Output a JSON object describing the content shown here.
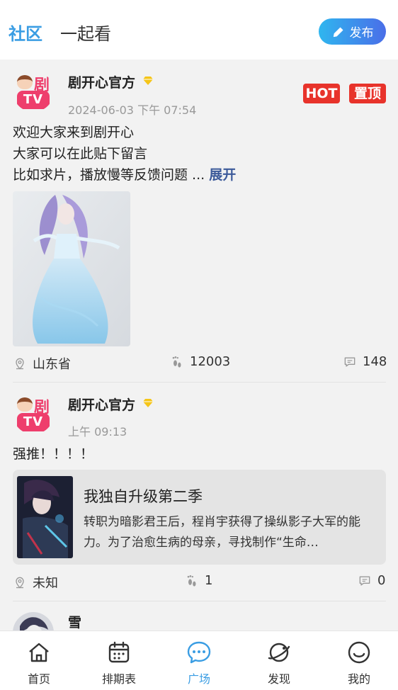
{
  "header": {
    "tabs": [
      {
        "label": "社区",
        "active": true
      },
      {
        "label": "一起看",
        "active": false
      }
    ],
    "publish_label": "发布"
  },
  "posts": [
    {
      "author": "剧开心官方",
      "time": "2024-06-03 下午 07:54",
      "badges": [
        "HOT",
        "置顶"
      ],
      "lines": [
        "欢迎大家来到剧开心",
        "大家可以在此贴下留言",
        "比如求片，播放慢等反馈问题 ..."
      ],
      "expand_label": "展开",
      "location": "山东省",
      "footprints": "12003",
      "comments": "148"
    },
    {
      "author": "剧开心官方",
      "time": "上午 09:13",
      "text": "强推！！！！",
      "card": {
        "title": "我独自升级第二季",
        "description": "转职为暗影君王后，程肖宇获得了操纵影子大军的能力。为了治愈生病的母亲，寻找制作“生命…"
      },
      "location": "未知",
      "footprints": "1",
      "comments": "0"
    },
    {
      "author": "雪"
    }
  ],
  "tabbar": [
    {
      "label": "首页",
      "icon": "home-icon",
      "active": false
    },
    {
      "label": "排期表",
      "icon": "calendar-icon",
      "active": false
    },
    {
      "label": "广场",
      "icon": "chat-bubble-icon",
      "active": true
    },
    {
      "label": "发现",
      "icon": "planet-icon",
      "active": false
    },
    {
      "label": "我的",
      "icon": "smile-icon",
      "active": false
    }
  ],
  "colors": {
    "accent": "#3a9de3",
    "badge": "#e8332b",
    "brand_pink": "#ee3e6c",
    "link": "#3c5a9a"
  }
}
